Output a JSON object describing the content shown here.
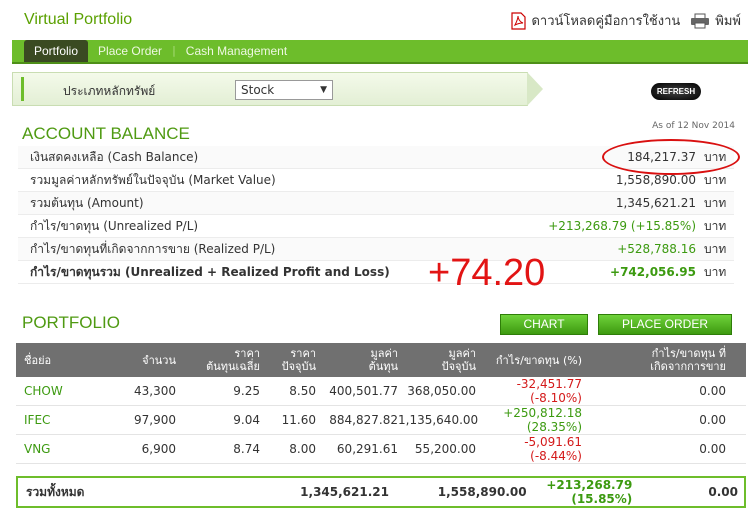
{
  "header": {
    "title": "Virtual Portfolio",
    "download_label": "ดาวน์โหลดคู่มือการใช้งาน",
    "print_label": "พิมพ์"
  },
  "nav": {
    "tabs": [
      "Portfolio",
      "Place Order",
      "Cash Management"
    ]
  },
  "filter": {
    "label": "ประเภทหลักทรัพย์",
    "selected": "Stock"
  },
  "refresh_label": "REFRESH",
  "account": {
    "title": "ACCOUNT BALANCE",
    "as_of": "As of 12 Nov 2014",
    "unit": "บาท",
    "rows": [
      {
        "label": "เงินสดคงเหลือ (Cash Balance)",
        "value": "184,217.37"
      },
      {
        "label": "รวมมูลค่าหลักทรัพย์ในปัจจุบัน (Market Value)",
        "value": "1,558,890.00"
      },
      {
        "label": "รวมต้นทุน (Amount)",
        "value": "1,345,621.21"
      },
      {
        "label": "กำไร/ขาดทุน (Unrealized P/L)",
        "value": "+213,268.79 (+15.85%)"
      },
      {
        "label": "กำไร/ขาดทุนที่เกิดจากการขาย (Realized P/L)",
        "value": "+528,788.16"
      },
      {
        "label": "กำไร/ขาดทุนรวม (Unrealized + Realized Profit and Loss)",
        "value": "+742,056.95"
      }
    ]
  },
  "annotation": "+74.20",
  "portfolio": {
    "title": "PORTFOLIO",
    "chart_button": "CHART",
    "order_button": "PLACE ORDER",
    "headers": [
      "ชื่อย่อ",
      "จำนวน",
      "ราคา\nต้นทุนเฉลี่ย",
      "ราคา\nปัจจุบัน",
      "มูลค่า\nต้นทุน",
      "มูลค่า\nปัจจุบัน",
      "กำไร/ขาดทุน (%)",
      "กำไร/ขาดทุน ที่\nเกิดจากการขาย"
    ],
    "rows": [
      {
        "symbol": "CHOW",
        "qty": "43,300",
        "avg_cost": "9.25",
        "price": "8.50",
        "cost_value": "400,501.77",
        "market_value": "368,050.00",
        "pl": "-32,451.77",
        "pl_pct": "(-8.10%)",
        "realized": "0.00"
      },
      {
        "symbol": "IFEC",
        "qty": "97,900",
        "avg_cost": "9.04",
        "price": "11.60",
        "cost_value": "884,827.82",
        "market_value": "1,135,640.00",
        "pl": "+250,812.18",
        "pl_pct": "(28.35%)",
        "realized": "0.00"
      },
      {
        "symbol": "VNG",
        "qty": "6,900",
        "avg_cost": "8.74",
        "price": "8.00",
        "cost_value": "60,291.61",
        "market_value": "55,200.00",
        "pl": "-5,091.61",
        "pl_pct": "(-8.44%)",
        "realized": "0.00"
      }
    ],
    "total": {
      "label": "รวมทั้งหมด",
      "cost_value": "1,345,621.21",
      "market_value": "1,558,890.00",
      "pl": "+213,268.79",
      "pl_pct": "(15.85%)",
      "realized": "0.00"
    }
  },
  "colors": {
    "brand_green": "#6dbd2b",
    "gain": "#3c9a10",
    "loss": "#d41a1a"
  }
}
